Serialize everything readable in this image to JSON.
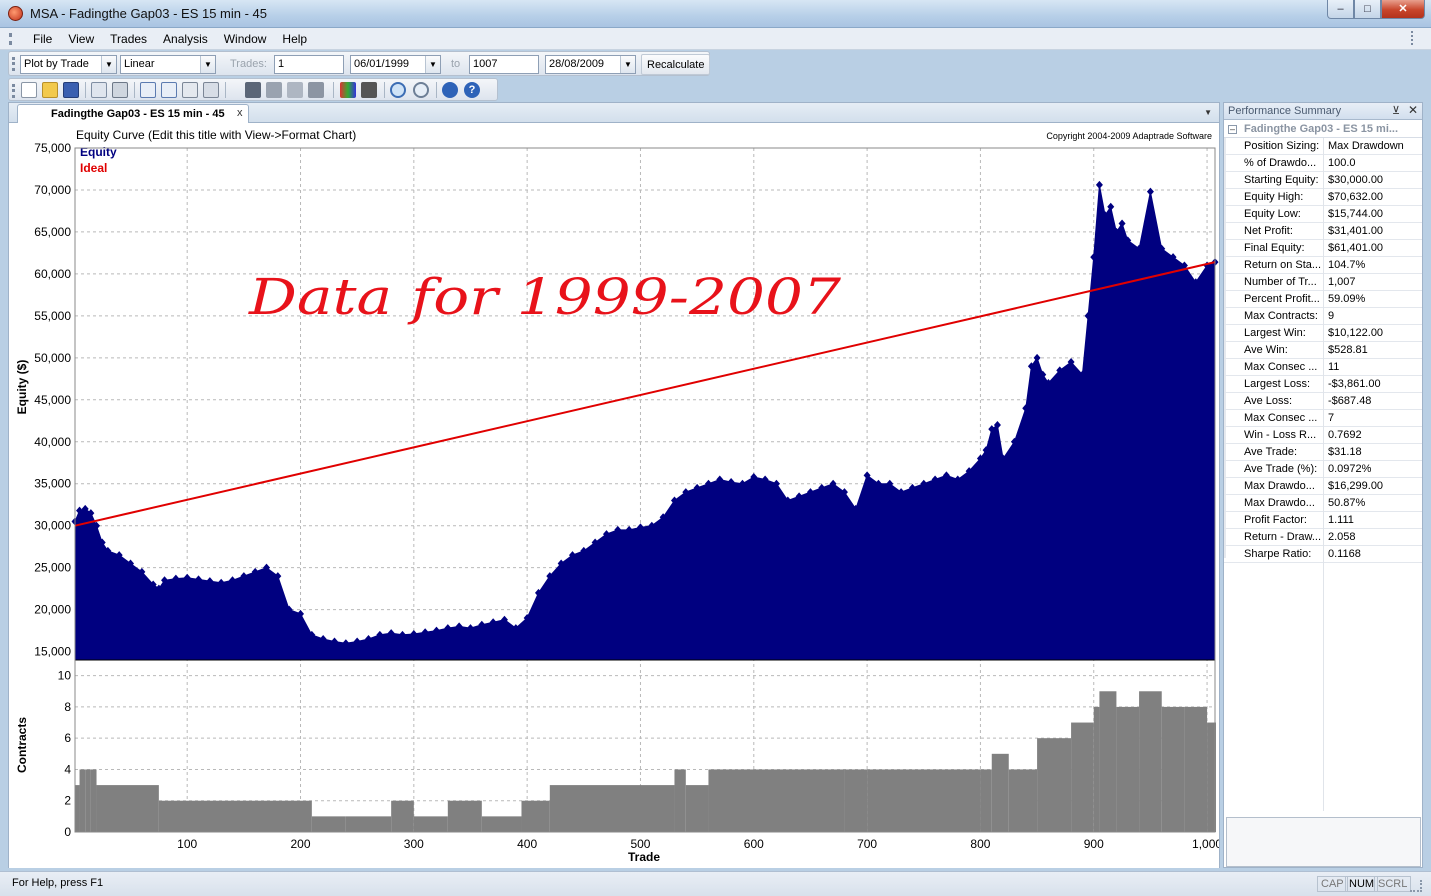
{
  "window": {
    "title": "MSA - Fadingthe Gap03 - ES 15 min - 45"
  },
  "menu": [
    "File",
    "View",
    "Trades",
    "Analysis",
    "Window",
    "Help"
  ],
  "toolbar": {
    "plot_mode": "Plot by Trade",
    "scale": "Linear",
    "trades_label": "Trades:",
    "trades_from": "1",
    "date_from": "06/01/1999",
    "to_label": "to",
    "trades_to": "1007",
    "date_to": "28/08/2009",
    "recalc_label": "Recalculate"
  },
  "toolbar_icons": [
    "new-icon",
    "open-icon",
    "save-icon",
    "copy-icon",
    "print-icon",
    "edit-icon",
    "chart-edit-icon",
    "report-icon",
    "table-icon",
    "grid-icon",
    "bars-icon",
    "color-icon",
    "layout-icon",
    "zoom-in-icon",
    "zoom-icon",
    "about-icon",
    "help-icon"
  ],
  "doc_tab": {
    "label": "Fadingthe Gap03 - ES 15 min - 45",
    "close": "x"
  },
  "chart": {
    "title": "Equity Curve (Edit this title with View->Format Chart)",
    "copyright": "Copyright 2004-2009 Adaptrade Software",
    "annotation": "Data for 1999-2007",
    "equity_ylabel": "Equity ($)",
    "contracts_ylabel": "Contracts",
    "xlabel": "Trade",
    "legend": [
      {
        "label": "Equity",
        "color": "#000080"
      },
      {
        "label": "Ideal",
        "color": "#e00000"
      }
    ],
    "equity_ticks": [
      "75,000",
      "70,000",
      "65,000",
      "60,000",
      "55,000",
      "50,000",
      "45,000",
      "40,000",
      "35,000",
      "30,000",
      "25,000",
      "20,000",
      "15,000"
    ],
    "contracts_ticks": [
      "10",
      "8",
      "6",
      "4",
      "2",
      "0"
    ],
    "x_ticks": [
      "100",
      "200",
      "300",
      "400",
      "500",
      "600",
      "700",
      "800",
      "900",
      "1,000"
    ]
  },
  "chart_data": [
    {
      "type": "area",
      "title": "Equity Curve (Edit this title with View->Format Chart)",
      "xlabel": "Trade",
      "ylabel": "Equity ($)",
      "xlim": [
        1,
        1007
      ],
      "ylim": [
        14000,
        75000
      ],
      "grid": true,
      "legend_position": "top-left",
      "series": [
        {
          "name": "Equity",
          "color": "#000080",
          "x": [
            1,
            5,
            10,
            15,
            20,
            25,
            30,
            40,
            50,
            60,
            70,
            75,
            80,
            90,
            100,
            110,
            120,
            130,
            140,
            150,
            160,
            170,
            180,
            190,
            200,
            210,
            220,
            230,
            240,
            250,
            260,
            270,
            280,
            290,
            300,
            310,
            320,
            330,
            340,
            350,
            360,
            370,
            380,
            390,
            400,
            410,
            420,
            430,
            440,
            450,
            460,
            470,
            480,
            490,
            500,
            510,
            520,
            530,
            540,
            550,
            560,
            570,
            580,
            590,
            600,
            610,
            620,
            630,
            640,
            650,
            660,
            670,
            680,
            690,
            700,
            710,
            720,
            730,
            740,
            750,
            760,
            770,
            780,
            790,
            800,
            805,
            810,
            815,
            820,
            830,
            840,
            845,
            850,
            855,
            860,
            870,
            880,
            890,
            895,
            900,
            905,
            910,
            915,
            920,
            925,
            930,
            940,
            950,
            960,
            970,
            980,
            990,
            1000,
            1007
          ],
          "values": [
            30500,
            31800,
            32000,
            31500,
            30000,
            28000,
            27000,
            26500,
            25500,
            24500,
            23000,
            22500,
            23500,
            23700,
            23800,
            23600,
            23400,
            23200,
            23500,
            24000,
            24500,
            25000,
            24000,
            20000,
            19500,
            17000,
            16500,
            16200,
            16000,
            16200,
            16500,
            17000,
            17200,
            17000,
            17100,
            17300,
            17500,
            17800,
            18000,
            17800,
            18200,
            18500,
            18800,
            17800,
            19000,
            22000,
            24000,
            25500,
            26500,
            27000,
            28000,
            29000,
            29500,
            29500,
            29800,
            30000,
            31000,
            33000,
            34000,
            34500,
            35000,
            35500,
            35200,
            35000,
            35800,
            35500,
            35000,
            33000,
            33500,
            34000,
            34500,
            35000,
            34000,
            32000,
            36000,
            35000,
            35000,
            34000,
            34500,
            35000,
            35500,
            36000,
            35500,
            36500,
            38000,
            39000,
            41500,
            42000,
            38000,
            40000,
            44000,
            49000,
            50000,
            48000,
            47000,
            48500,
            49500,
            48000,
            55000,
            62000,
            70600,
            67000,
            68000,
            65000,
            66000,
            64000,
            63000,
            69800,
            63000,
            62000,
            61000,
            59000,
            61000,
            61400
          ]
        },
        {
          "name": "Ideal",
          "color": "#e00000",
          "x": [
            1,
            1007
          ],
          "values": [
            30000,
            61401
          ]
        }
      ]
    },
    {
      "type": "bar",
      "xlabel": "Trade",
      "ylabel": "Contracts",
      "xlim": [
        1,
        1007
      ],
      "ylim": [
        0,
        11
      ],
      "grid": true,
      "series": [
        {
          "name": "",
          "color": "#808080",
          "x": [
            1,
            5,
            10,
            15,
            20,
            75,
            210,
            240,
            280,
            300,
            330,
            360,
            395,
            420,
            530,
            540,
            560,
            680,
            700,
            800,
            810,
            825,
            850,
            880,
            900,
            905,
            920,
            940,
            960,
            980,
            1000,
            1007
          ],
          "values": [
            3,
            4,
            4,
            4,
            3,
            2,
            1,
            1,
            2,
            1,
            2,
            1,
            2,
            3,
            4,
            3,
            4,
            4,
            4,
            4,
            5,
            4,
            6,
            7,
            8,
            9,
            8,
            9,
            8,
            8,
            7,
            7
          ]
        }
      ]
    }
  ],
  "performance": {
    "title": "Performance Summary",
    "group": "Fadingthe Gap03 - ES 15 mi...",
    "rows": [
      {
        "k": "Position Sizing:",
        "v": "Max Drawdown"
      },
      {
        "k": "% of Drawdo...",
        "v": "100.0"
      },
      {
        "k": "Starting Equity:",
        "v": "$30,000.00"
      },
      {
        "k": "Equity High:",
        "v": "$70,632.00"
      },
      {
        "k": "Equity Low:",
        "v": "$15,744.00"
      },
      {
        "k": "Net Profit:",
        "v": "$31,401.00"
      },
      {
        "k": "Final Equity:",
        "v": "$61,401.00"
      },
      {
        "k": "Return on Sta...",
        "v": "104.7%"
      },
      {
        "k": "Number of Tr...",
        "v": "1,007"
      },
      {
        "k": "Percent Profit...",
        "v": "59.09%"
      },
      {
        "k": "Max Contracts:",
        "v": "9"
      },
      {
        "k": "Largest Win:",
        "v": "$10,122.00"
      },
      {
        "k": "Ave Win:",
        "v": "$528.81"
      },
      {
        "k": "Max Consec ...",
        "v": "11"
      },
      {
        "k": "Largest Loss:",
        "v": "-$3,861.00"
      },
      {
        "k": "Ave Loss:",
        "v": "-$687.48"
      },
      {
        "k": "Max Consec ...",
        "v": "7"
      },
      {
        "k": "Win - Loss R...",
        "v": "0.7692"
      },
      {
        "k": "Ave Trade:",
        "v": "$31.18"
      },
      {
        "k": "Ave Trade (%):",
        "v": "0.0972%"
      },
      {
        "k": "Max Drawdo...",
        "v": "$16,299.00"
      },
      {
        "k": "Max Drawdo...",
        "v": "50.87%"
      },
      {
        "k": "Profit Factor:",
        "v": "1.111"
      },
      {
        "k": "Return - Draw...",
        "v": "2.058"
      },
      {
        "k": "Sharpe Ratio:",
        "v": "0.1168"
      }
    ]
  },
  "status": {
    "message": "For Help, press F1",
    "indicators": [
      {
        "label": "CAP",
        "on": false
      },
      {
        "label": "NUM",
        "on": true
      },
      {
        "label": "SCRL",
        "on": false
      }
    ]
  }
}
